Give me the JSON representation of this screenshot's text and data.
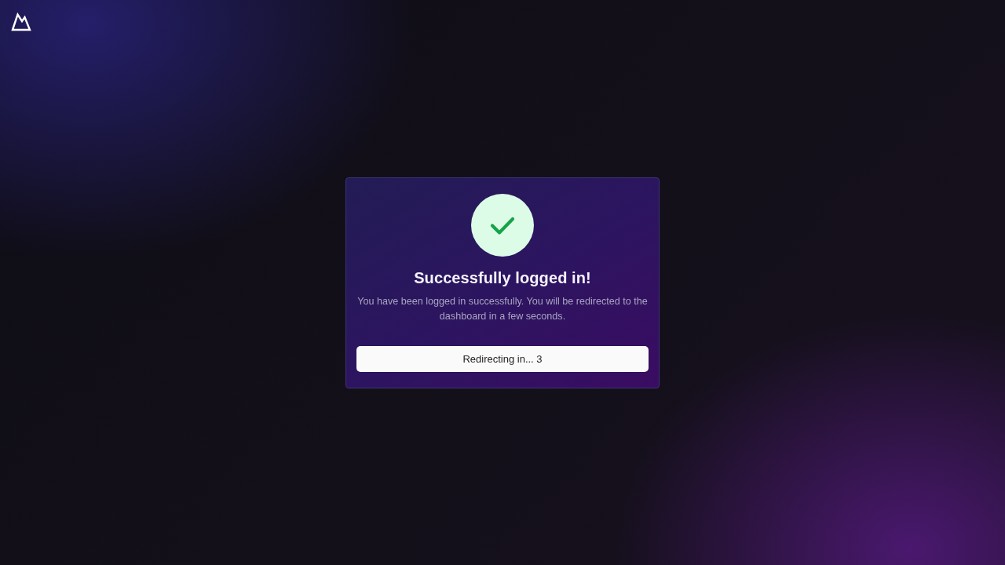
{
  "card": {
    "title": "Successfully logged in!",
    "message": "You have been logged in successfully. You will be redirected to the dashboard in a few seconds.",
    "button": "Redirecting in... 3"
  }
}
